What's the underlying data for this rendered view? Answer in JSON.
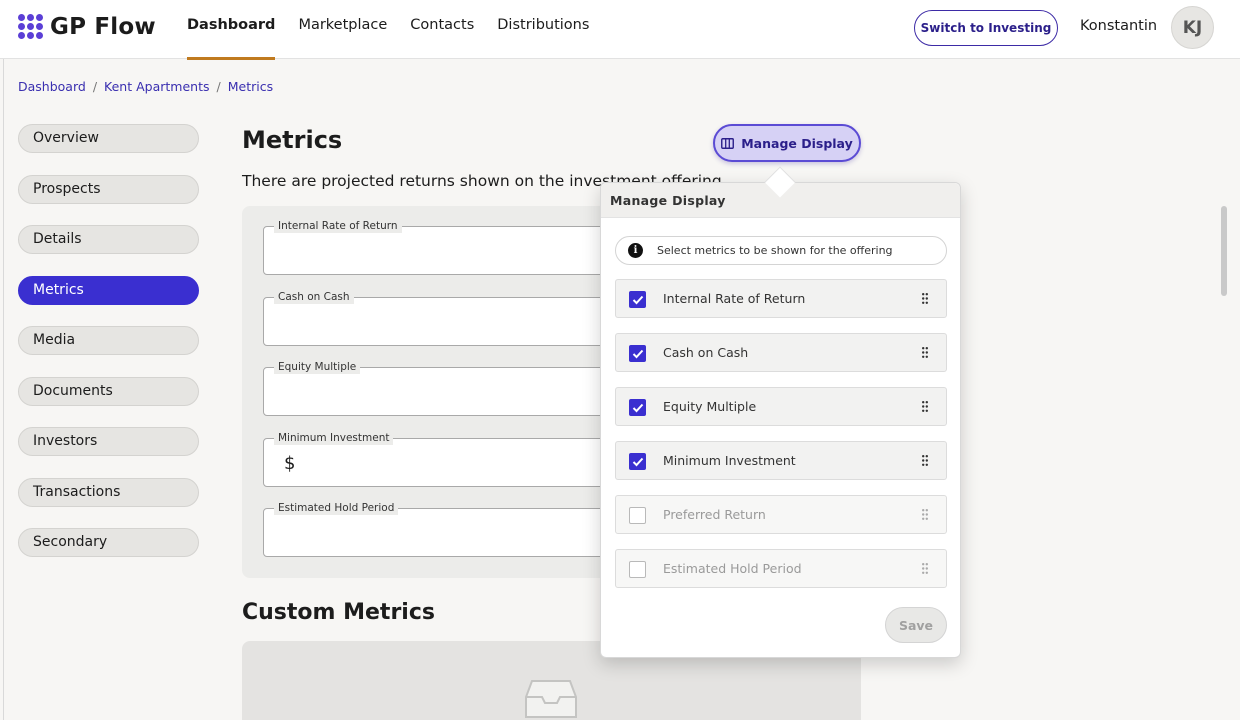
{
  "app": {
    "logo_text": "GP Flow",
    "brand_color": "#5b3fd6"
  },
  "nav": {
    "items": [
      {
        "label": "Dashboard",
        "active": true
      },
      {
        "label": "Marketplace",
        "active": false
      },
      {
        "label": "Contacts",
        "active": false
      },
      {
        "label": "Distributions",
        "active": false
      }
    ],
    "active_indicator_color": "#c07a1f"
  },
  "header": {
    "switch_button": "Switch to Investing",
    "user_name": "Konstantin",
    "avatar_initials": "KJ"
  },
  "breadcrumb": [
    "Dashboard",
    "Kent Apartments",
    "Metrics"
  ],
  "sidebar": {
    "items": [
      {
        "label": "Overview"
      },
      {
        "label": "Prospects"
      },
      {
        "label": "Details"
      },
      {
        "label": "Metrics",
        "active": true
      },
      {
        "label": "Media"
      },
      {
        "label": "Documents"
      },
      {
        "label": "Investors"
      },
      {
        "label": "Transactions"
      },
      {
        "label": "Secondary"
      }
    ],
    "active_color": "#3a2fd0"
  },
  "main": {
    "title": "Metrics",
    "subtitle": "There are projected returns shown on the investment offering.",
    "manage_display_button": "Manage Display",
    "fields": [
      {
        "label": "Internal Rate of Return",
        "value": "",
        "prefix": ""
      },
      {
        "label": "Cash on Cash",
        "value": "",
        "prefix": ""
      },
      {
        "label": "Equity Multiple",
        "value": "",
        "prefix": ""
      },
      {
        "label": "Minimum Investment",
        "value": "",
        "prefix": "$"
      },
      {
        "label": "Estimated Hold Period",
        "value": "",
        "prefix": ""
      }
    ],
    "custom_metrics_title": "Custom Metrics"
  },
  "popover": {
    "title": "Manage Display",
    "info_text": "Select metrics to be shown for the offering",
    "options": [
      {
        "label": "Internal Rate of Return",
        "checked": true
      },
      {
        "label": "Cash on Cash",
        "checked": true
      },
      {
        "label": "Equity Multiple",
        "checked": true
      },
      {
        "label": "Minimum Investment",
        "checked": true
      },
      {
        "label": "Preferred Return",
        "checked": false
      },
      {
        "label": "Estimated Hold Period",
        "checked": false
      }
    ],
    "save_button": "Save",
    "checkbox_color": "#3a2fd0"
  }
}
